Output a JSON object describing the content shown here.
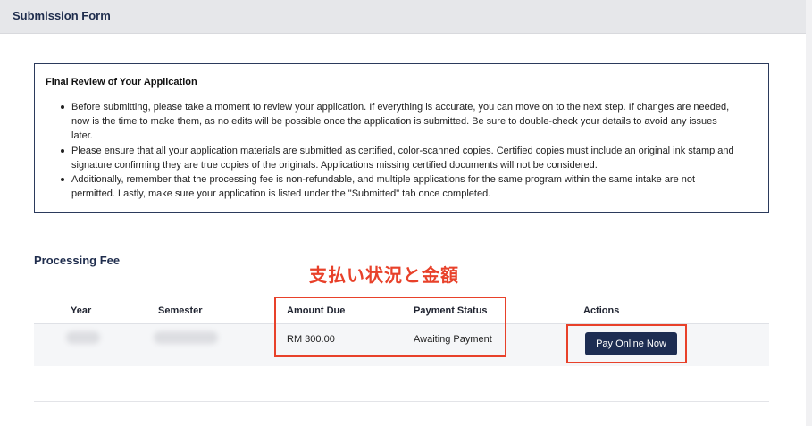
{
  "header": {
    "title": "Submission Form"
  },
  "review": {
    "title": "Final Review of Your Application",
    "items": [
      "Before submitting, please take a moment to review your application. If everything is accurate, you can move on to the next step. If changes are needed, now is the time to make them, as no edits will be possible once the application is submitted. Be sure to double-check your details to avoid any issues later.",
      "Please ensure that all your application materials are submitted as certified, color-scanned copies. Certified copies must include an original ink stamp and signature confirming they are true copies of the originals. Applications missing certified documents will not be considered.",
      "Additionally, remember that the processing fee is non-refundable, and multiple applications for the same program within the same intake are not permitted. Lastly, make sure your application is listed under the \"Submitted\" tab once completed."
    ]
  },
  "fee": {
    "title": "Processing Fee",
    "annotation": "支払い状況と金額",
    "columns": {
      "year": "Year",
      "semester": "Semester",
      "amount_due": "Amount Due",
      "payment_status": "Payment Status",
      "actions": "Actions"
    },
    "rows": [
      {
        "amount_due": "RM 300.00",
        "payment_status": "Awaiting Payment",
        "action_label": "Pay Online Now"
      }
    ]
  },
  "colors": {
    "primary": "#1d2d52",
    "annotation": "#e8412a",
    "header_bg": "#e6e7ea"
  }
}
